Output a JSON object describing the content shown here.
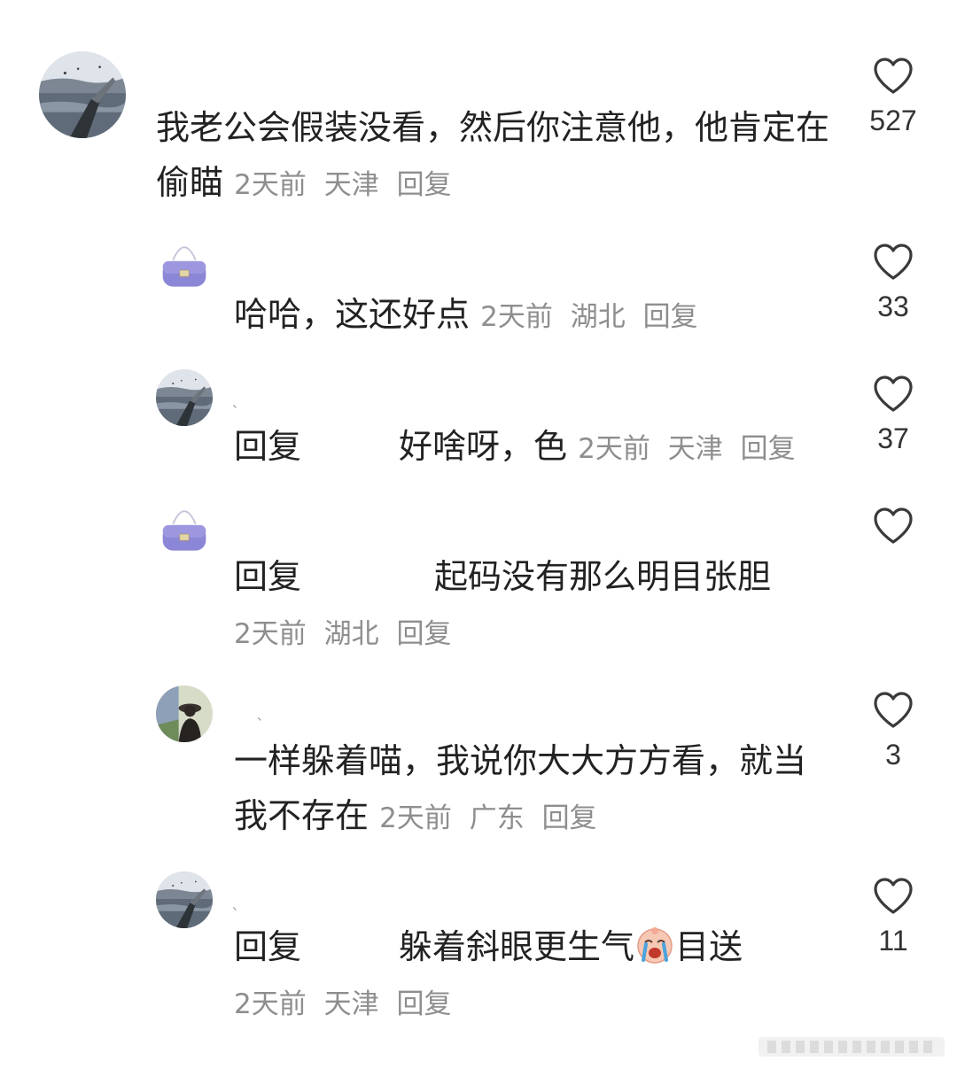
{
  "comments": [
    {
      "text": "我老公会假装没看，然后你注意他，他肯定在偷瞄",
      "time": "2天前",
      "location": "天津",
      "reply_label": "回复",
      "likes": "527"
    },
    {
      "text": "哈哈，这还好点",
      "time": "2天前",
      "location": "湖北",
      "reply_label": "回复",
      "likes": "33"
    },
    {
      "username": "、",
      "prefix": "回复",
      "text": "好啥呀，色",
      "time": "2天前",
      "location": "天津",
      "reply_label": "回复",
      "likes": "37"
    },
    {
      "prefix": "回复",
      "text": "起码没有那么明目张胆",
      "time": "2天前",
      "location": "湖北",
      "reply_label": "回复",
      "likes": ""
    },
    {
      "username": "、",
      "text": "一样躲着喵，我说你大大方方看，就当我不存在",
      "time": "2天前",
      "location": "广东",
      "reply_label": "回复",
      "likes": "3"
    },
    {
      "username": "、",
      "prefix": "回复",
      "text_before": "躲着斜眼更生气",
      "emoji": "crying-face-emoji",
      "text_after": "目送",
      "time": "2天前",
      "location": "天津",
      "reply_label": "回复",
      "likes": "11"
    }
  ],
  "icons": {
    "like": "heart-outline-icon"
  },
  "colors": {
    "text": "#222222",
    "meta": "#8e8e8e",
    "avatar_purple": "#8c86d6"
  }
}
